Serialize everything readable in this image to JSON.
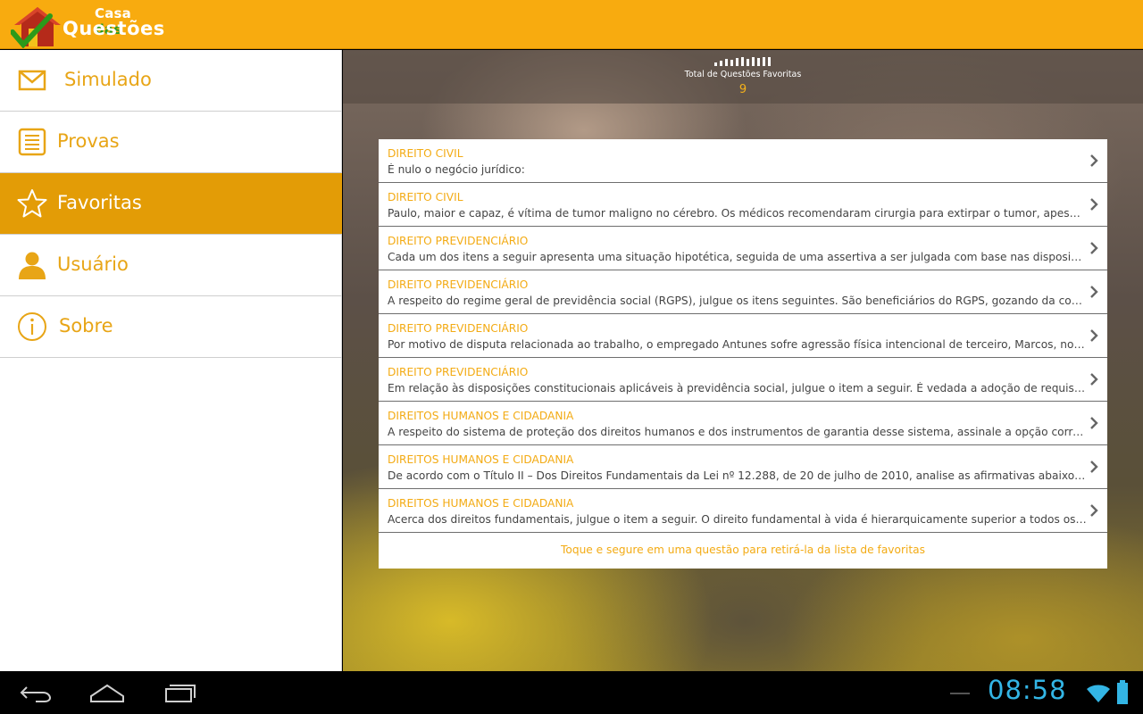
{
  "app": {
    "logo_line1_a": "Casa",
    "logo_line1_b": "das",
    "logo_line2": "Questões"
  },
  "sidebar": {
    "items": [
      {
        "label": "Simulado",
        "icon": "envelope-icon"
      },
      {
        "label": "Provas",
        "icon": "list-icon"
      },
      {
        "label": "Favoritas",
        "icon": "star-icon",
        "active": true
      },
      {
        "label": "Usuário",
        "icon": "user-icon"
      },
      {
        "label": "Sobre",
        "icon": "info-icon"
      }
    ]
  },
  "stats": {
    "label": "Total de Questões Favoritas",
    "value": "9"
  },
  "list": {
    "items": [
      {
        "category": "DIREITO CIVIL",
        "text": "É nulo o negócio jurídico:"
      },
      {
        "category": "DIREITO CIVIL",
        "text": "Paulo, maior e capaz, é vítima de tumor maligno no cérebro. Os médicos recomendaram cirurgia para extirpar o tumor, apesar do risco de vida..."
      },
      {
        "category": "DIREITO PREVIDENCIÁRIO",
        "text": "Cada um dos itens a seguir apresenta uma situação hipotética, seguida de uma assertiva a ser julgada com base nas disposições do direito..."
      },
      {
        "category": "DIREITO PREVIDENCIÁRIO",
        "text": " A respeito do regime geral de previdência social (RGPS), julgue os itens seguintes.  São beneficiários do RGPS, gozando da condição de segurado..."
      },
      {
        "category": "DIREITO PREVIDENCIÁRIO",
        "text": " Por motivo de disputa relacionada ao trabalho, o empregado Antunes sofre agressão física intencional de terceiro, Marcos, no refeitório da empresa..."
      },
      {
        "category": "DIREITO PREVIDENCIÁRIO",
        "text": "Em relação às disposições constitucionais aplicáveis à previdência social, julgue o item a seguir.  É vedada a adoção de requisitos e critérios..."
      },
      {
        "category": "DIREITOS HUMANOS E CIDADANIA",
        "text": "A respeito do sistema de proteção dos direitos humanos e dos instrumentos de garantia desse sistema, assinale a opção correta."
      },
      {
        "category": "DIREITOS HUMANOS E CIDADANIA",
        "text": "De acordo com o Título II – Dos Direitos Fundamentais da Lei nº 12.288, de 20 de julho de 2010, analise as afirmativas abaixo, assinalando..."
      },
      {
        "category": "DIREITOS HUMANOS E CIDADANIA",
        "text": "Acerca dos direitos fundamentais, julgue o item a seguir.  O direito fundamental à vida é hierarquicamente superior a todos os demais direitos..."
      }
    ],
    "footnote": "Toque e segure em uma questão para retirá-la da lista de favoritas"
  },
  "system": {
    "clock": "08:58",
    "nav": [
      "back-icon",
      "home-icon",
      "recent-apps-icon"
    ],
    "colors": {
      "accent": "#f8ab0f",
      "clock": "#33b5e5",
      "category": "#f3ab14"
    }
  }
}
